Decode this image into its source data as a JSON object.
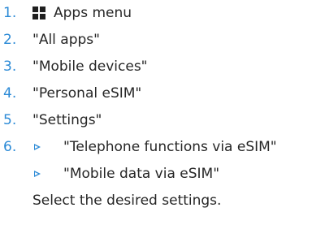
{
  "steps": [
    {
      "number": "1.",
      "icon": "apps-grid-icon",
      "label": "Apps menu"
    },
    {
      "number": "2.",
      "label": "\"All apps\""
    },
    {
      "number": "3.",
      "label": "\"Mobile devices\""
    },
    {
      "number": "4.",
      "label": "\"Personal eSIM\""
    },
    {
      "number": "5.",
      "label": "\"Settings\""
    },
    {
      "number": "6.",
      "options": [
        "\"Telephone functions via eSIM\"",
        "\"Mobile data via eSIM\""
      ]
    }
  ],
  "instruction": "Select the desired settings.",
  "colors": {
    "step_number": "#2b8ad6",
    "text": "#262626",
    "bullet": "#2b8ad6"
  }
}
